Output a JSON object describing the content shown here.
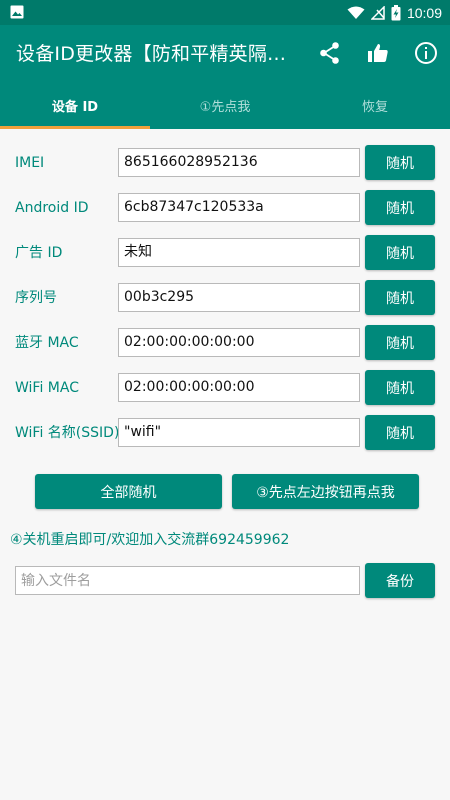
{
  "status_bar": {
    "time": "10:09",
    "icons": [
      "gallery-icon",
      "wifi-icon",
      "signal-off-icon",
      "battery-charging-icon"
    ]
  },
  "app_bar": {
    "title": "设备ID更改器【防和平精英隔…",
    "actions": [
      "share-icon",
      "thumbs-up-icon",
      "info-icon"
    ]
  },
  "tabs": [
    {
      "label": "设备 ID",
      "active": true
    },
    {
      "label": "①先点我",
      "active": false
    },
    {
      "label": "恢复",
      "active": false
    }
  ],
  "fields": [
    {
      "label": "IMEI",
      "value": "865166028952136",
      "button": "随机"
    },
    {
      "label": "Android ID",
      "value": "6cb87347c120533a",
      "button": "随机"
    },
    {
      "label": "广告 ID",
      "value": "未知",
      "button": "随机"
    },
    {
      "label": "序列号",
      "value": "00b3c295",
      "button": "随机"
    },
    {
      "label": "蓝牙 MAC",
      "value": "02:00:00:00:00:00",
      "button": "随机"
    },
    {
      "label": "WiFi MAC",
      "value": "02:00:00:00:00:00",
      "button": "随机"
    },
    {
      "label": "WiFi 名称(SSID)",
      "value": "\"wifi\"",
      "button": "随机"
    }
  ],
  "actions": {
    "randomize_all": "全部随机",
    "step_three": "③先点左边按钮再点我"
  },
  "note": "④关机重启即可/欢迎加入交流群692459962",
  "backup": {
    "placeholder": "输入文件名",
    "value": "",
    "button": "备份"
  },
  "colors": {
    "primary": "#00897b",
    "status_bar": "#007a6a",
    "tab_indicator": "#f0a03c",
    "background": "#f7f7f7"
  }
}
